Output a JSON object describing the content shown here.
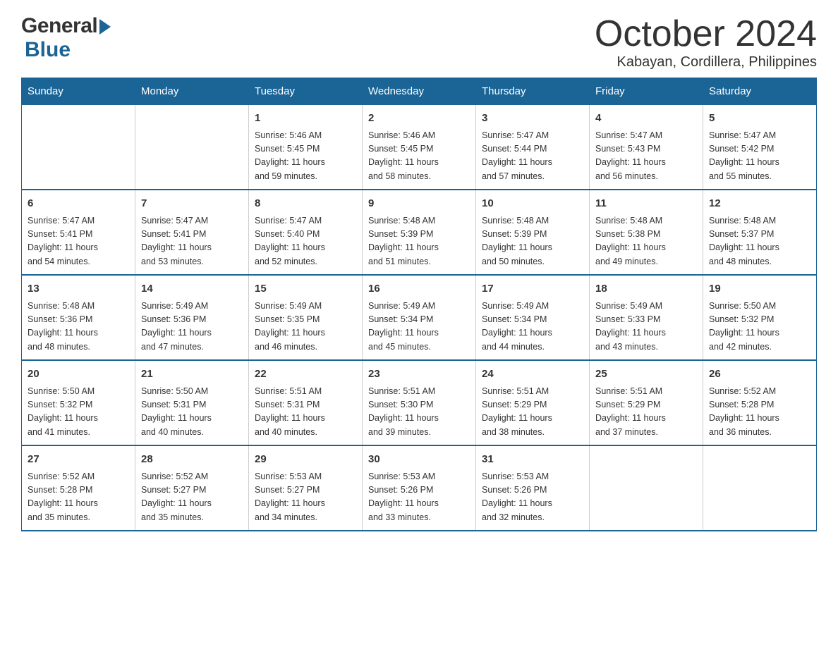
{
  "header": {
    "logo": {
      "general": "General",
      "blue": "Blue"
    },
    "title": "October 2024",
    "location": "Kabayan, Cordillera, Philippines"
  },
  "calendar": {
    "days_of_week": [
      "Sunday",
      "Monday",
      "Tuesday",
      "Wednesday",
      "Thursday",
      "Friday",
      "Saturday"
    ],
    "weeks": [
      [
        {
          "day": "",
          "info": ""
        },
        {
          "day": "",
          "info": ""
        },
        {
          "day": "1",
          "info": "Sunrise: 5:46 AM\nSunset: 5:45 PM\nDaylight: 11 hours\nand 59 minutes."
        },
        {
          "day": "2",
          "info": "Sunrise: 5:46 AM\nSunset: 5:45 PM\nDaylight: 11 hours\nand 58 minutes."
        },
        {
          "day": "3",
          "info": "Sunrise: 5:47 AM\nSunset: 5:44 PM\nDaylight: 11 hours\nand 57 minutes."
        },
        {
          "day": "4",
          "info": "Sunrise: 5:47 AM\nSunset: 5:43 PM\nDaylight: 11 hours\nand 56 minutes."
        },
        {
          "day": "5",
          "info": "Sunrise: 5:47 AM\nSunset: 5:42 PM\nDaylight: 11 hours\nand 55 minutes."
        }
      ],
      [
        {
          "day": "6",
          "info": "Sunrise: 5:47 AM\nSunset: 5:41 PM\nDaylight: 11 hours\nand 54 minutes."
        },
        {
          "day": "7",
          "info": "Sunrise: 5:47 AM\nSunset: 5:41 PM\nDaylight: 11 hours\nand 53 minutes."
        },
        {
          "day": "8",
          "info": "Sunrise: 5:47 AM\nSunset: 5:40 PM\nDaylight: 11 hours\nand 52 minutes."
        },
        {
          "day": "9",
          "info": "Sunrise: 5:48 AM\nSunset: 5:39 PM\nDaylight: 11 hours\nand 51 minutes."
        },
        {
          "day": "10",
          "info": "Sunrise: 5:48 AM\nSunset: 5:39 PM\nDaylight: 11 hours\nand 50 minutes."
        },
        {
          "day": "11",
          "info": "Sunrise: 5:48 AM\nSunset: 5:38 PM\nDaylight: 11 hours\nand 49 minutes."
        },
        {
          "day": "12",
          "info": "Sunrise: 5:48 AM\nSunset: 5:37 PM\nDaylight: 11 hours\nand 48 minutes."
        }
      ],
      [
        {
          "day": "13",
          "info": "Sunrise: 5:48 AM\nSunset: 5:36 PM\nDaylight: 11 hours\nand 48 minutes."
        },
        {
          "day": "14",
          "info": "Sunrise: 5:49 AM\nSunset: 5:36 PM\nDaylight: 11 hours\nand 47 minutes."
        },
        {
          "day": "15",
          "info": "Sunrise: 5:49 AM\nSunset: 5:35 PM\nDaylight: 11 hours\nand 46 minutes."
        },
        {
          "day": "16",
          "info": "Sunrise: 5:49 AM\nSunset: 5:34 PM\nDaylight: 11 hours\nand 45 minutes."
        },
        {
          "day": "17",
          "info": "Sunrise: 5:49 AM\nSunset: 5:34 PM\nDaylight: 11 hours\nand 44 minutes."
        },
        {
          "day": "18",
          "info": "Sunrise: 5:49 AM\nSunset: 5:33 PM\nDaylight: 11 hours\nand 43 minutes."
        },
        {
          "day": "19",
          "info": "Sunrise: 5:50 AM\nSunset: 5:32 PM\nDaylight: 11 hours\nand 42 minutes."
        }
      ],
      [
        {
          "day": "20",
          "info": "Sunrise: 5:50 AM\nSunset: 5:32 PM\nDaylight: 11 hours\nand 41 minutes."
        },
        {
          "day": "21",
          "info": "Sunrise: 5:50 AM\nSunset: 5:31 PM\nDaylight: 11 hours\nand 40 minutes."
        },
        {
          "day": "22",
          "info": "Sunrise: 5:51 AM\nSunset: 5:31 PM\nDaylight: 11 hours\nand 40 minutes."
        },
        {
          "day": "23",
          "info": "Sunrise: 5:51 AM\nSunset: 5:30 PM\nDaylight: 11 hours\nand 39 minutes."
        },
        {
          "day": "24",
          "info": "Sunrise: 5:51 AM\nSunset: 5:29 PM\nDaylight: 11 hours\nand 38 minutes."
        },
        {
          "day": "25",
          "info": "Sunrise: 5:51 AM\nSunset: 5:29 PM\nDaylight: 11 hours\nand 37 minutes."
        },
        {
          "day": "26",
          "info": "Sunrise: 5:52 AM\nSunset: 5:28 PM\nDaylight: 11 hours\nand 36 minutes."
        }
      ],
      [
        {
          "day": "27",
          "info": "Sunrise: 5:52 AM\nSunset: 5:28 PM\nDaylight: 11 hours\nand 35 minutes."
        },
        {
          "day": "28",
          "info": "Sunrise: 5:52 AM\nSunset: 5:27 PM\nDaylight: 11 hours\nand 35 minutes."
        },
        {
          "day": "29",
          "info": "Sunrise: 5:53 AM\nSunset: 5:27 PM\nDaylight: 11 hours\nand 34 minutes."
        },
        {
          "day": "30",
          "info": "Sunrise: 5:53 AM\nSunset: 5:26 PM\nDaylight: 11 hours\nand 33 minutes."
        },
        {
          "day": "31",
          "info": "Sunrise: 5:53 AM\nSunset: 5:26 PM\nDaylight: 11 hours\nand 32 minutes."
        },
        {
          "day": "",
          "info": ""
        },
        {
          "day": "",
          "info": ""
        }
      ]
    ]
  }
}
